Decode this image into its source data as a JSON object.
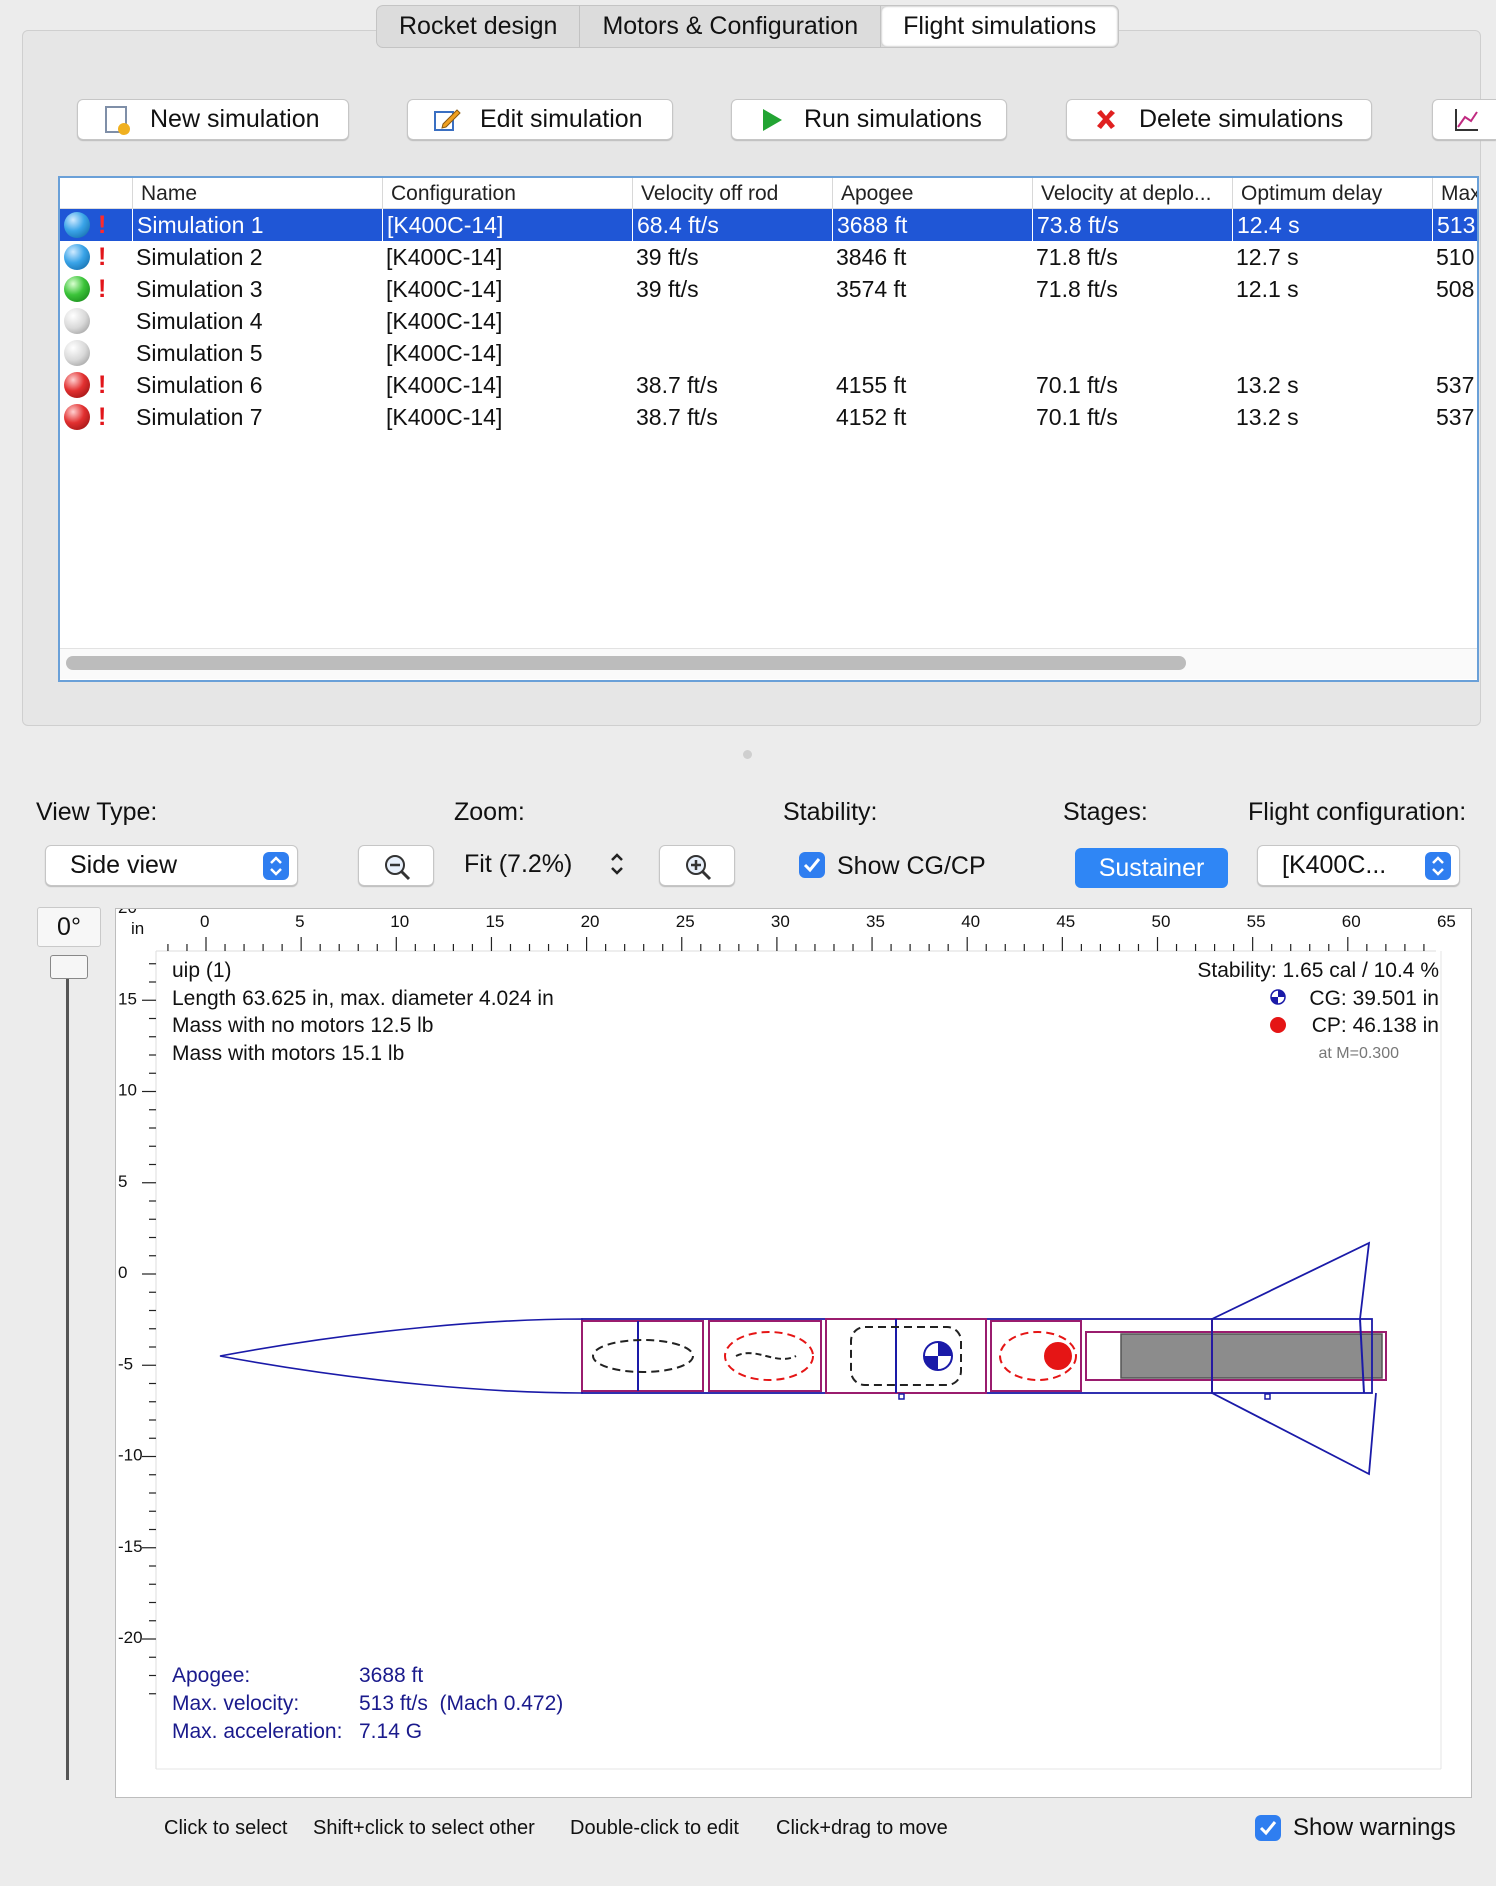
{
  "tabs": [
    {
      "label": "Rocket design",
      "active": false
    },
    {
      "label": "Motors & Configuration",
      "active": false
    },
    {
      "label": "Flight simulations",
      "active": true
    }
  ],
  "toolbar": {
    "new_simulation": "New simulation",
    "edit_simulation": "Edit simulation",
    "run_simulations": "Run simulations",
    "delete_simulations": "Delete simulations"
  },
  "table": {
    "columns": [
      "Name",
      "Configuration",
      "Velocity off rod",
      "Apogee",
      "Velocity at deplo...",
      "Optimum delay",
      "Max"
    ],
    "rows": [
      {
        "status": "blue",
        "warning": "!",
        "name": "Simulation 1",
        "config": "[K400C-14]",
        "vel_off_rod": "68.4 ft/s",
        "apogee": "3688 ft",
        "vel_deploy": "73.8 ft/s",
        "opt_delay": "12.4 s",
        "max": "513",
        "selected": true
      },
      {
        "status": "blue",
        "warning": "!",
        "name": "Simulation 2",
        "config": "[K400C-14]",
        "vel_off_rod": "39 ft/s",
        "apogee": "3846 ft",
        "vel_deploy": "71.8 ft/s",
        "opt_delay": "12.7 s",
        "max": "510",
        "selected": false
      },
      {
        "status": "green",
        "warning": "!",
        "name": "Simulation 3",
        "config": "[K400C-14]",
        "vel_off_rod": "39 ft/s",
        "apogee": "3574 ft",
        "vel_deploy": "71.8 ft/s",
        "opt_delay": "12.1 s",
        "max": "508",
        "selected": false
      },
      {
        "status": "gray",
        "warning": "",
        "name": "Simulation 4",
        "config": "[K400C-14]",
        "vel_off_rod": "",
        "apogee": "",
        "vel_deploy": "",
        "opt_delay": "",
        "max": "",
        "selected": false
      },
      {
        "status": "gray",
        "warning": "",
        "name": "Simulation 5",
        "config": "[K400C-14]",
        "vel_off_rod": "",
        "apogee": "",
        "vel_deploy": "",
        "opt_delay": "",
        "max": "",
        "selected": false
      },
      {
        "status": "red",
        "warning": "!",
        "name": "Simulation 6",
        "config": "[K400C-14]",
        "vel_off_rod": "38.7 ft/s",
        "apogee": "4155 ft",
        "vel_deploy": "70.1 ft/s",
        "opt_delay": "13.2 s",
        "max": "537",
        "selected": false
      },
      {
        "status": "red",
        "warning": "!",
        "name": "Simulation 7",
        "config": "[K400C-14]",
        "vel_off_rod": "38.7 ft/s",
        "apogee": "4152 ft",
        "vel_deploy": "70.1 ft/s",
        "opt_delay": "13.2 s",
        "max": "537",
        "selected": false
      }
    ]
  },
  "controls": {
    "view_type_label": "View Type:",
    "view_type_value": "Side view",
    "zoom_label": "Zoom:",
    "zoom_value": "Fit (7.2%)",
    "stability_label": "Stability:",
    "show_cgcp_label": "Show CG/CP",
    "stages_label": "Stages:",
    "stage_button": "Sustainer",
    "flight_config_label": "Flight configuration:",
    "flight_config_value": "[K400C..."
  },
  "rotation": "0°",
  "ruler": {
    "unit": "in",
    "h_labels": [
      "0",
      "5",
      "10",
      "15",
      "20",
      "25",
      "30",
      "35",
      "40",
      "45",
      "50",
      "55",
      "60",
      "65"
    ],
    "v_labels": [
      "20",
      "15",
      "10",
      "5",
      "0",
      "-5",
      "-10",
      "-15",
      "-20"
    ]
  },
  "figure_info": {
    "name": "uip (1)",
    "length": "Length 63.625 in, max. diameter 4.024 in",
    "mass_no_motors": "Mass with no motors 12.5 lb",
    "mass_with_motors": "Mass with motors 15.1 lb",
    "stability": "Stability: 1.65 cal / 10.4 %",
    "cg": "CG: 39.501 in",
    "cp": "CP: 46.138 in",
    "mach": "at M=0.300",
    "apogee_label": "Apogee:",
    "apogee_value": "3688 ft",
    "max_velocity_label": "Max. velocity:",
    "max_velocity_value": "513 ft/s  (Mach 0.472)",
    "max_accel_label": "Max. acceleration:",
    "max_accel_value": "7.14 G"
  },
  "footer": {
    "hints": [
      "Click to select",
      "Shift+click to select other",
      "Double-click to edit",
      "Click+drag to move"
    ],
    "show_warnings": "Show warnings"
  },
  "colors": {
    "selection": "#1f56d6",
    "accent": "#2f7ef0",
    "rocket_outline": "#1a1aa8",
    "component_outline": "#9a1c6e",
    "cp_red": "#e51515"
  }
}
